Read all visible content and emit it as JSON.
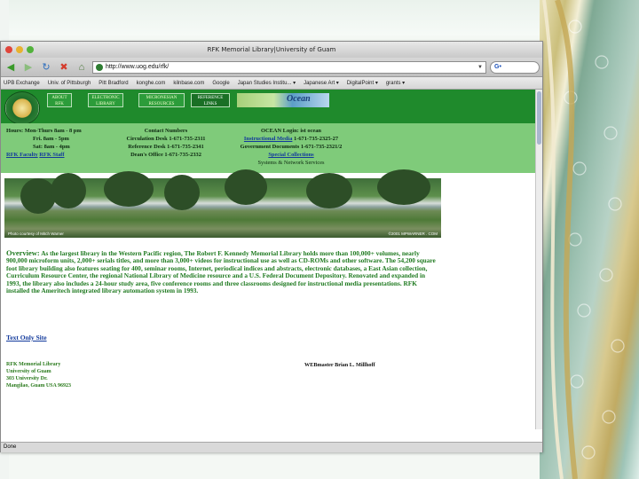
{
  "window": {
    "title": "RFK Memorial Library|University of Guam"
  },
  "toolbar": {
    "url": "http://www.uog.edu/rfk/",
    "search_value": "G•"
  },
  "bookmarks": [
    "UPB Exchange",
    "Univ. of Pittsburgh",
    "Pitt Bradford",
    "konghe.com",
    "kilnbase.com",
    "Google",
    "Japan Studies Institu... ▾",
    "Japanese Art ▾",
    "DigitalPoint ▾",
    "grants ▾"
  ],
  "site_nav": {
    "tabs": [
      "ABOUT RFK",
      "ELECTRONIC LIBRARY",
      "MICRONESIAN RESOURCES",
      "REFERENCE LINKS"
    ],
    "ocean_label": "Ocean"
  },
  "hours": {
    "line1": "Hours: Mon-Thurs 8am - 8 pm",
    "line2": "Fri. 8am - 5pm",
    "line3": "Sat: 8am - 4pm",
    "link1": "RFK Faculty",
    "link2": "RFK Staff"
  },
  "contacts": {
    "heading": "Contact Numbers",
    "line1": "Circulation Desk 1-671-735-2311",
    "line2": "Reference Desk 1-671-735-2341",
    "line3": "Dean's Office 1-671-735-2332"
  },
  "ocean_login": {
    "heading": "OCEAN Login: ist ocean",
    "media_link": "Instructional Media",
    "media_phone": "1-671-735-2325-27",
    "govdocs": "Government Documents 1-671-735-2321/2",
    "special_link": "Special Collections",
    "systems": "Systems & Network Services"
  },
  "photo": {
    "credit_left": "Photo courtesy of Mitch Warner",
    "credit_right": "©2001 MPWARNER . COM"
  },
  "overview": {
    "label": "Overview:",
    "text": "As the largest library in the Western Pacific region, The Robert F. Kennedy Memorial Library holds more than 100,000+ volumes, nearly 900,000 microform units, 2,000+ serials titles, and more than 3,000+ videos for instructional use as well as CD-ROMs and other software. The 54,200 square foot library building also features seating for 400, seminar rooms, Internet, periodical indices and abstracts, electronic databases, a East Asian collection, Curriculum Resource Center, the regional National Library of Medicine resource and a U.S. Federal Document Depository. Renovated and expanded in 1993, the library also includes a 24-hour study area, five conference rooms and three classrooms designed for instructional media presentations. RFK installed the Ameritech integrated library automation system in 1993."
  },
  "text_only_link": "Text Only Site",
  "address": {
    "line1": "RFK Memorial Library",
    "line2": "University of Guam",
    "line3": "303 University Dr.",
    "line4": "Mangilao, Guam USA 96923"
  },
  "webmaster": {
    "label": "WEBmaster",
    "name": "Brian L. Millhoff"
  },
  "status": "Done"
}
